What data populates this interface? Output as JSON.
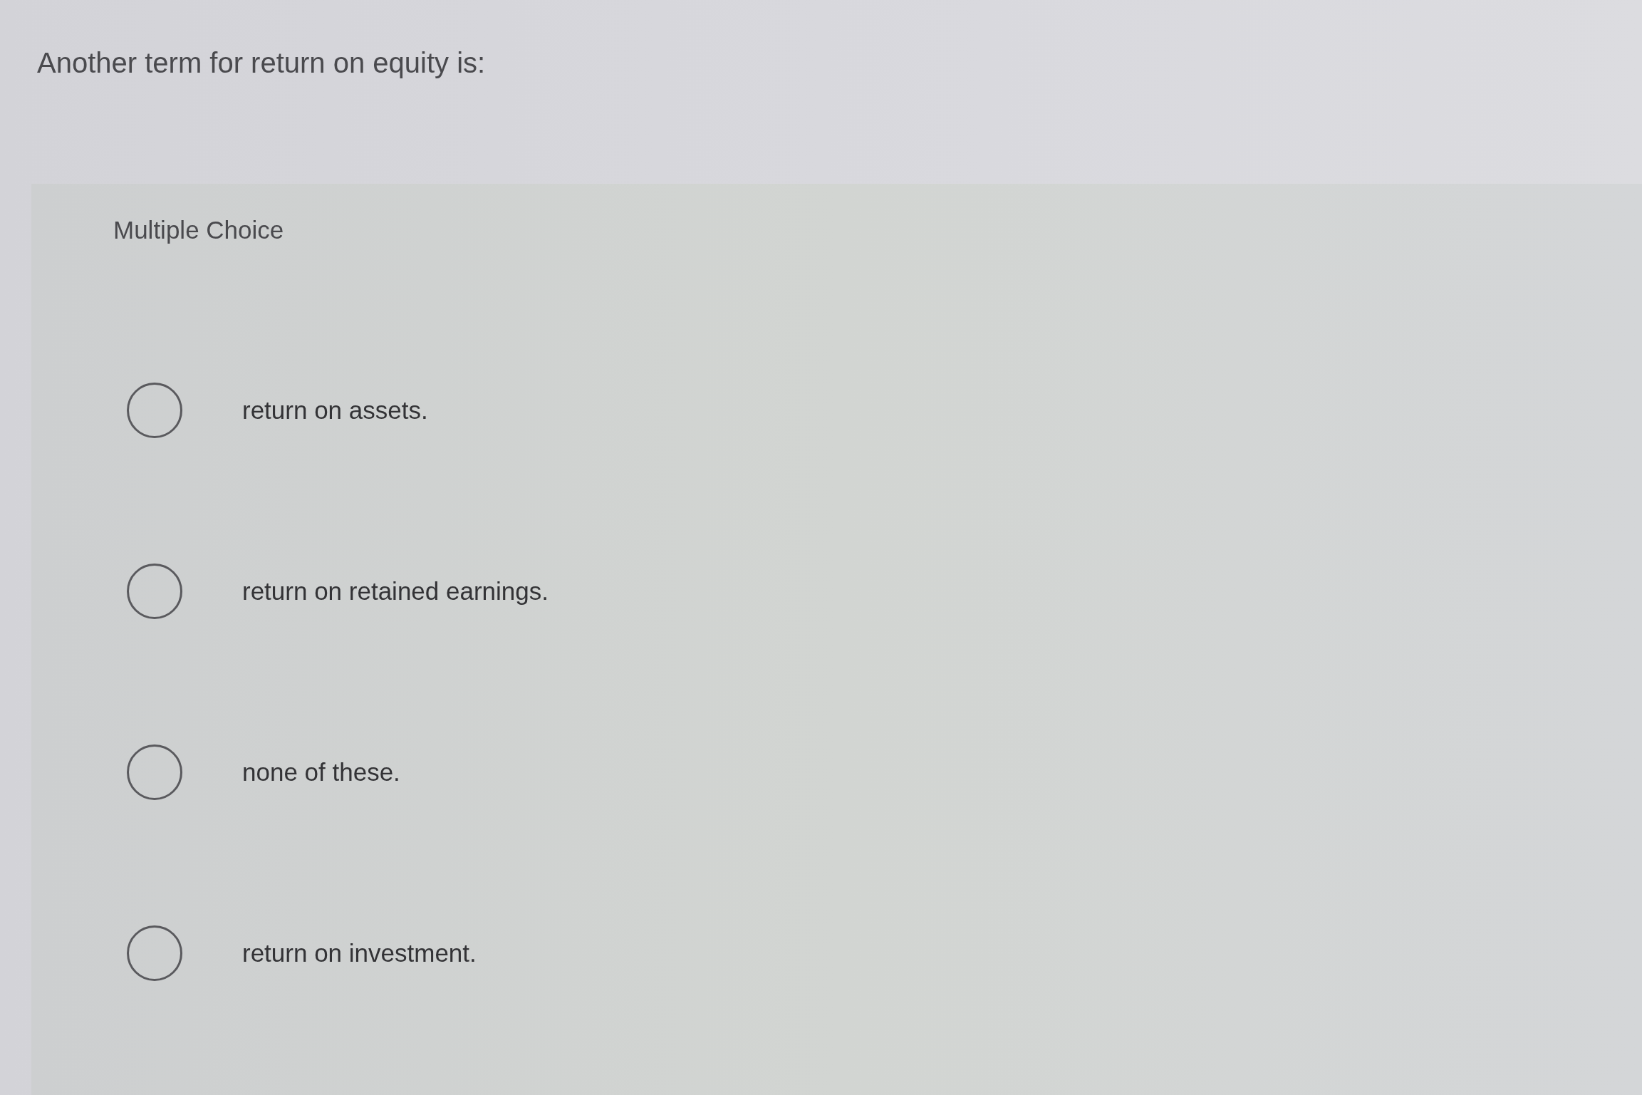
{
  "question": "Another term for return on equity is:",
  "section_label": "Multiple Choice",
  "options": [
    {
      "label": "return on assets.",
      "selected": false
    },
    {
      "label": "return on retained earnings.",
      "selected": false
    },
    {
      "label": "none of these.",
      "selected": false
    },
    {
      "label": "return on investment.",
      "selected": false
    }
  ]
}
